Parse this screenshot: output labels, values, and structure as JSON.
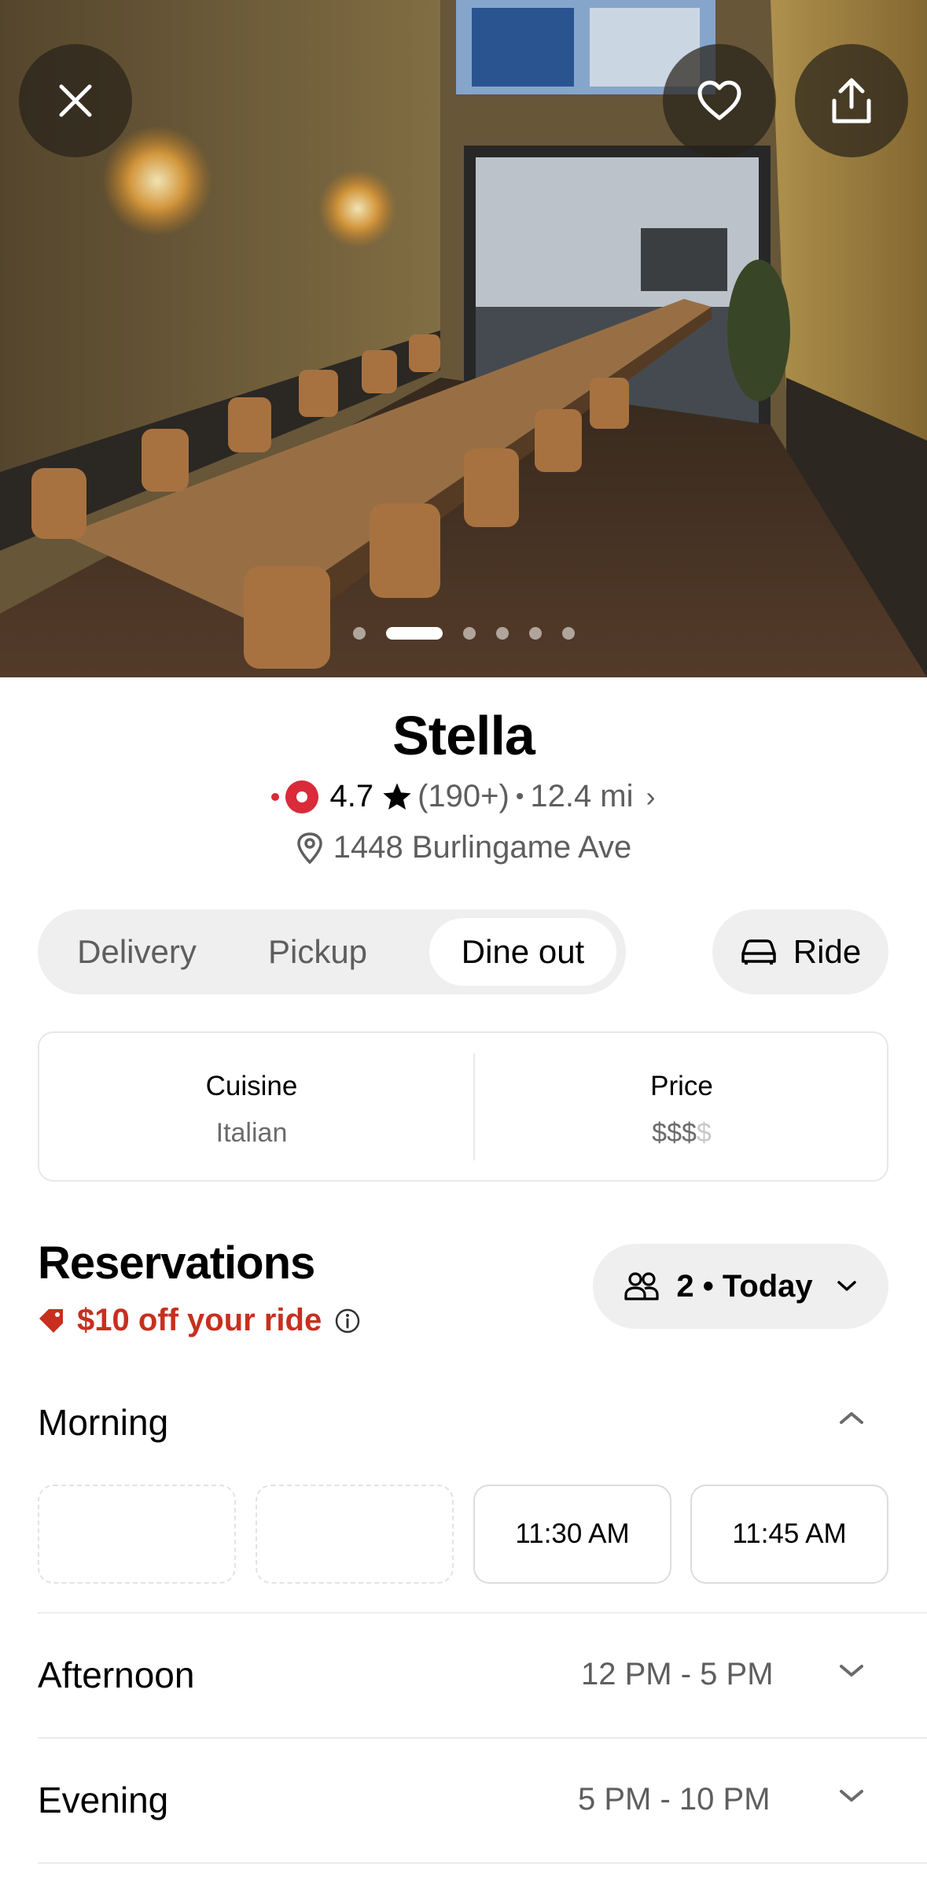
{
  "restaurant": {
    "name": "Stella",
    "rating": "4.7",
    "review_count": "(190+)",
    "distance": "12.4 mi",
    "address": "1448 Burlingame Ave",
    "brand_color": "#d92b3a"
  },
  "gallery": {
    "photo_count": 6,
    "active_index": 1
  },
  "header_buttons": {
    "close_icon": "close-icon",
    "favorite_icon": "heart-icon",
    "share_icon": "share-icon"
  },
  "modes": {
    "tabs": [
      {
        "label": "Delivery"
      },
      {
        "label": "Pickup"
      },
      {
        "label": "Dine out",
        "selected": true
      }
    ],
    "ride_label": "Ride"
  },
  "info_card": {
    "cuisine_label": "Cuisine",
    "cuisine_value": "Italian",
    "price_label": "Price",
    "price_value_active": "$$$",
    "price_value_inactive": "$"
  },
  "reservations": {
    "title": "Reservations",
    "promo": "$10 off your ride",
    "promo_color": "#c82f1f",
    "party": "2 • Today"
  },
  "sections": [
    {
      "title": "Morning",
      "range": "",
      "expanded": true,
      "slots": [
        "",
        "",
        "11:30 AM",
        "11:45 AM"
      ]
    },
    {
      "title": "Afternoon",
      "range": "12 PM - 5 PM",
      "expanded": false
    },
    {
      "title": "Evening",
      "range": "5 PM - 10 PM",
      "expanded": false
    }
  ]
}
